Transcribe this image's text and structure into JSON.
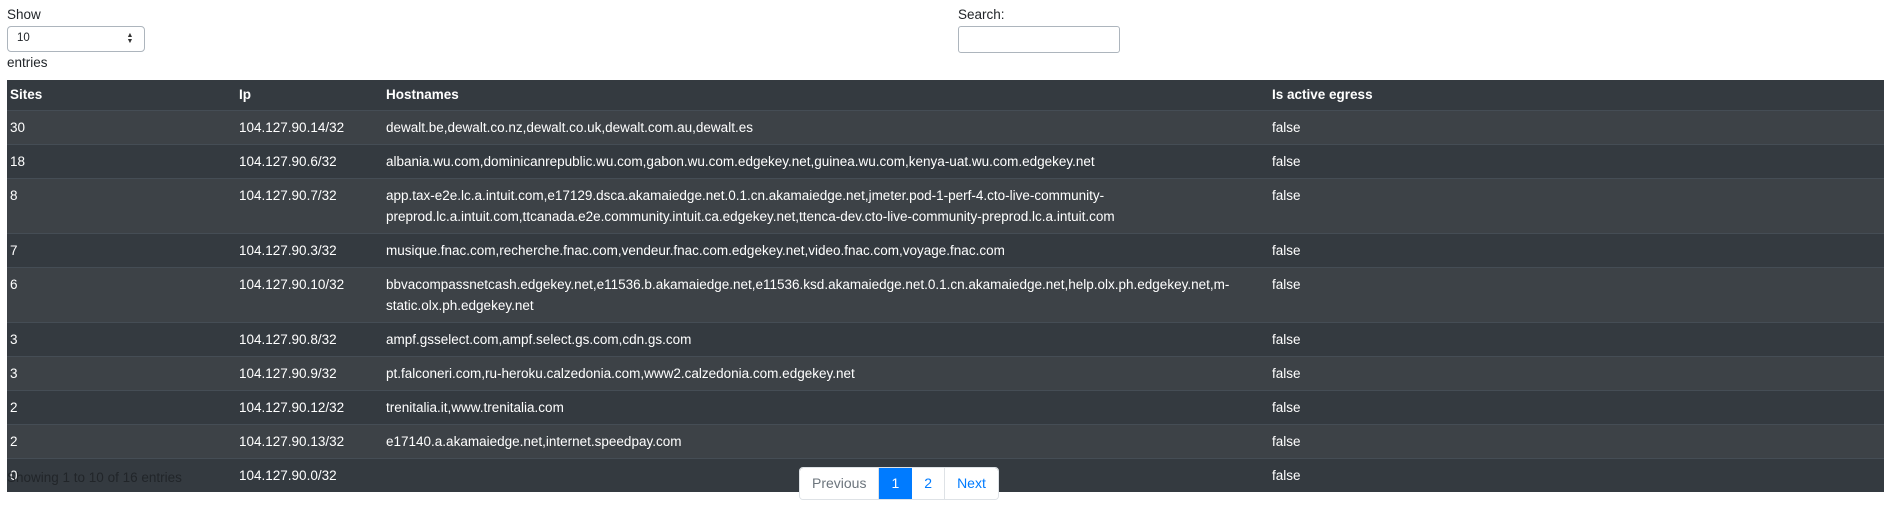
{
  "length_control": {
    "show_label": "Show",
    "selected": "10",
    "entries_label": "entries"
  },
  "search": {
    "label": "Search:",
    "value": ""
  },
  "table": {
    "headers": [
      "Sites",
      "Ip",
      "Hostnames",
      "Is active egress"
    ],
    "rows": [
      [
        "30",
        "104.127.90.14/32",
        "dewalt.be,dewalt.co.nz,dewalt.co.uk,dewalt.com.au,dewalt.es",
        "false"
      ],
      [
        "18",
        "104.127.90.6/32",
        "albania.wu.com,dominicanrepublic.wu.com,gabon.wu.com.edgekey.net,guinea.wu.com,kenya-uat.wu.com.edgekey.net",
        "false"
      ],
      [
        "8",
        "104.127.90.7/32",
        "app.tax-e2e.lc.a.intuit.com,e17129.dsca.akamaiedge.net.0.1.cn.akamaiedge.net,jmeter.pod-1-perf-4.cto-live-community-preprod.lc.a.intuit.com,ttcanada.e2e.community.intuit.ca.edgekey.net,ttenca-dev.cto-live-community-preprod.lc.a.intuit.com",
        "false"
      ],
      [
        "7",
        "104.127.90.3/32",
        "musique.fnac.com,recherche.fnac.com,vendeur.fnac.com.edgekey.net,video.fnac.com,voyage.fnac.com",
        "false"
      ],
      [
        "6",
        "104.127.90.10/32",
        "bbvacompassnetcash.edgekey.net,e11536.b.akamaiedge.net,e11536.ksd.akamaiedge.net.0.1.cn.akamaiedge.net,help.olx.ph.edgekey.net,m-static.olx.ph.edgekey.net",
        "false"
      ],
      [
        "3",
        "104.127.90.8/32",
        "ampf.gsselect.com,ampf.select.gs.com,cdn.gs.com",
        "false"
      ],
      [
        "3",
        "104.127.90.9/32",
        "pt.falconeri.com,ru-heroku.calzedonia.com,www2.calzedonia.com.edgekey.net",
        "false"
      ],
      [
        "2",
        "104.127.90.12/32",
        "trenitalia.it,www.trenitalia.com",
        "false"
      ],
      [
        "2",
        "104.127.90.13/32",
        "e17140.a.akamaiedge.net,internet.speedpay.com",
        "false"
      ],
      [
        "0",
        "104.127.90.0/32",
        "",
        "false"
      ]
    ]
  },
  "info": "Showing 1 to 10 of 16 entries",
  "pagination": {
    "previous": "Previous",
    "pages": [
      "1",
      "2"
    ],
    "active_page": "1",
    "next": "Next"
  },
  "colors": {
    "header_bg": "#343a40",
    "row_odd_bg": "#3d4247",
    "row_even_bg": "#343a40",
    "accent": "#007bff"
  },
  "icons": {
    "select_caret": "up-down-caret-icon"
  }
}
